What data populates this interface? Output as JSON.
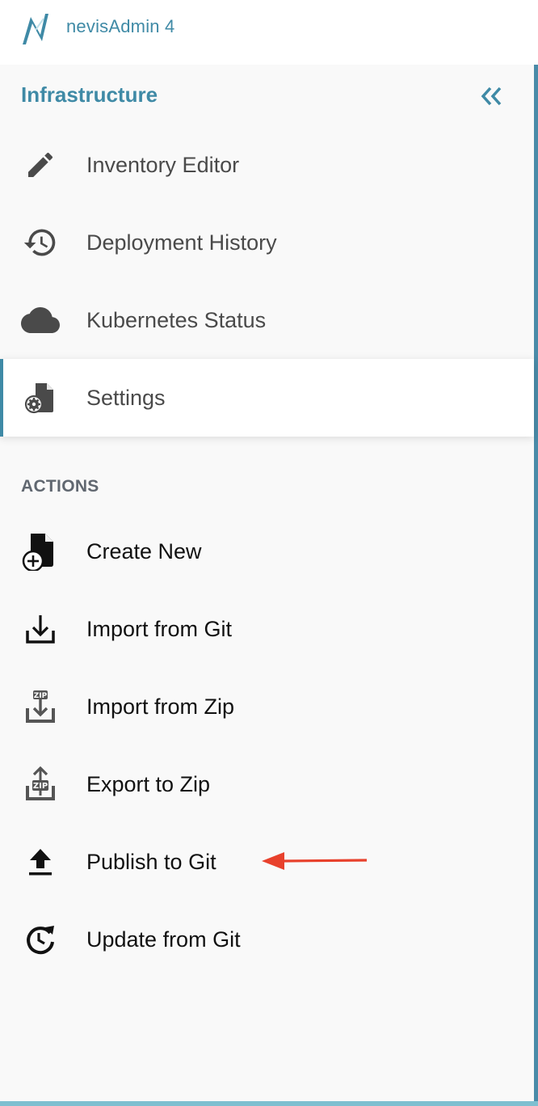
{
  "app": {
    "title": "nevisAdmin 4",
    "logo_icon": "nevis-logo-icon"
  },
  "sidebar": {
    "section_title": "Infrastructure",
    "collapse_icon": "double-chevron-left-icon",
    "nav_items": [
      {
        "label": "Inventory Editor",
        "icon": "pencil-icon",
        "active": false
      },
      {
        "label": "Deployment History",
        "icon": "history-icon",
        "active": false
      },
      {
        "label": "Kubernetes Status",
        "icon": "cloud-icon",
        "active": false
      },
      {
        "label": "Settings",
        "icon": "file-settings-icon",
        "active": true
      }
    ],
    "actions_header": "ACTIONS",
    "actions": [
      {
        "label": "Create New",
        "icon": "file-plus-icon"
      },
      {
        "label": "Import from Git",
        "icon": "download-tray-icon"
      },
      {
        "label": "Import from Zip",
        "icon": "zip-import-icon"
      },
      {
        "label": "Export to Zip",
        "icon": "zip-export-icon"
      },
      {
        "label": "Publish to Git",
        "icon": "upload-icon"
      },
      {
        "label": "Update from Git",
        "icon": "clock-refresh-icon"
      }
    ]
  },
  "annotation": {
    "type": "arrow",
    "points_to": "Publish to Git",
    "color": "#e8412c"
  },
  "colors": {
    "brand": "#3f8aa6",
    "nav_text": "#4a4a4a",
    "action_text": "#111111",
    "sidebar_bg": "#f9f9f9"
  }
}
